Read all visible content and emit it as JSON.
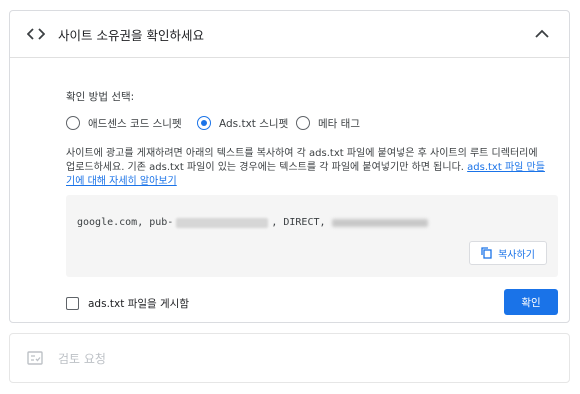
{
  "site_ownership": {
    "title": "사이트 소유권을 확인하세요",
    "method_label": "확인 방법 선택:",
    "options": [
      {
        "label": "애드센스 코드 스니펫",
        "selected": false
      },
      {
        "label": "Ads.txt 스니펫",
        "selected": true
      },
      {
        "label": "메타 태그",
        "selected": false
      }
    ],
    "description": "사이트에 광고를 게재하려면 아래의 텍스트를 복사하여 각 ads.txt 파일에 붙여넣은 후 사이트의 루트 디렉터리에 업로드하세요. 기존 ads.txt 파일이 있는 경우에는 텍스트를 각 파일에 붙여넣기만 하면 됩니다.",
    "link_text": "ads.txt 파일 만들기에 대해 자세히 알아보기",
    "code_prefix": "google.com, pub-",
    "code_middle": ", DIRECT, ",
    "copy_label": "복사하기",
    "checkbox_label": "ads.txt 파일을 게시함",
    "checkbox_checked": false,
    "confirm_label": "확인"
  },
  "review": {
    "title": "검토 요청"
  },
  "colors": {
    "accent": "#1a73e8",
    "disabled_text": "#bdc1c6"
  },
  "icons": {
    "header": "code-icon",
    "collapse": "chevron-up-icon",
    "copy": "copy-icon",
    "review": "review-icon"
  }
}
